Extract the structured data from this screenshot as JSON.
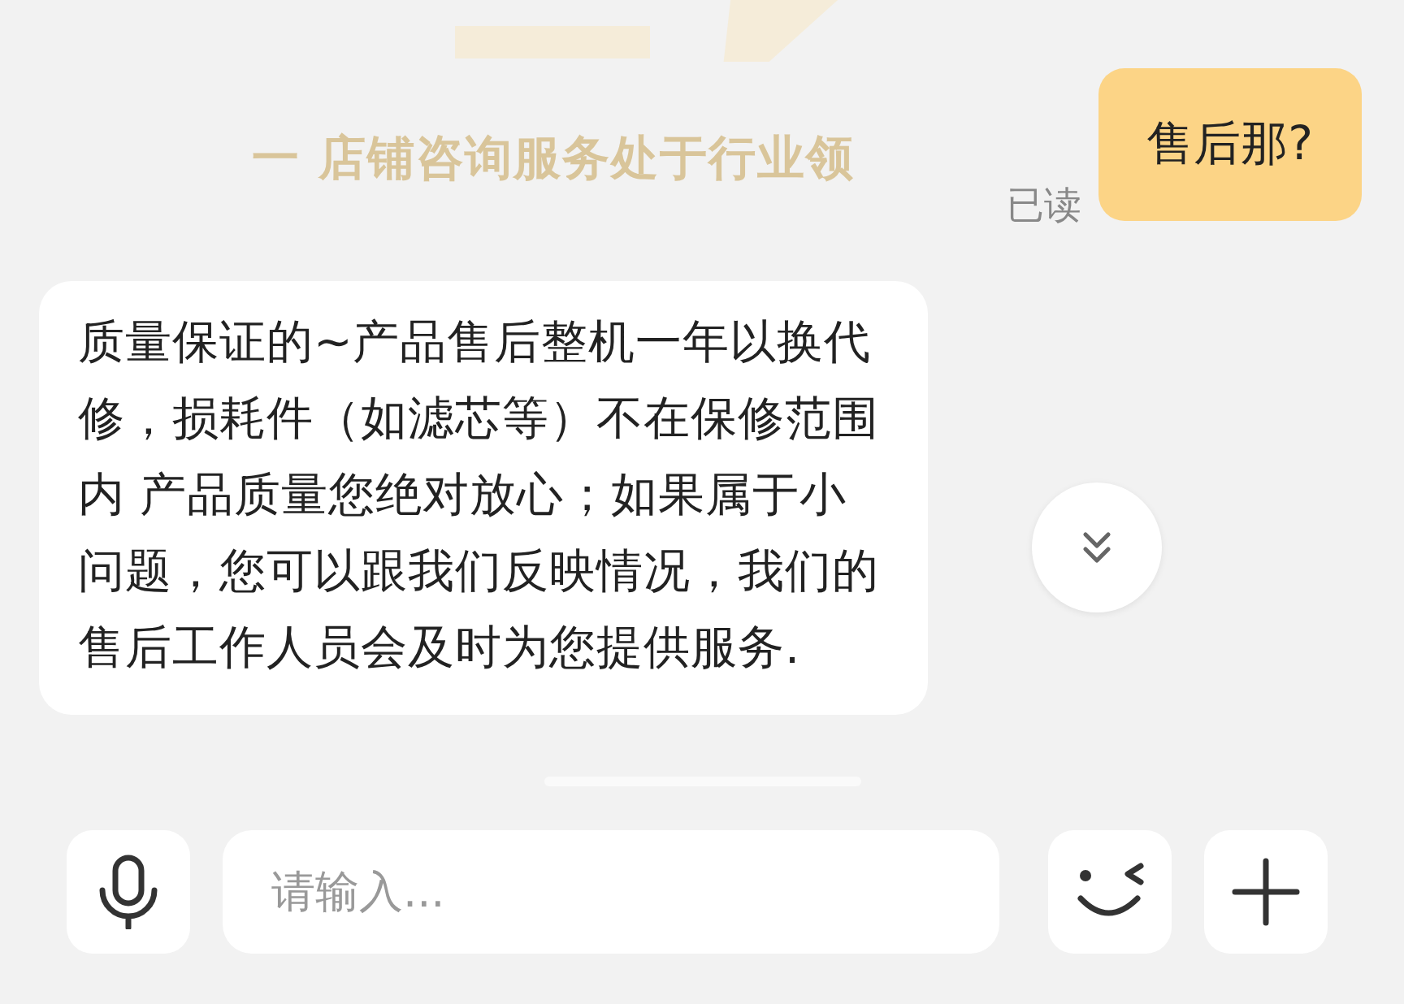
{
  "banner": {
    "text": "一 店铺咨询服务处于行业领"
  },
  "messages": [
    {
      "kind": "outgoing",
      "text": "售后那?",
      "status": "已读"
    },
    {
      "kind": "incoming",
      "lines": [
        "质量保证的~产品售后整机一年以换代",
        "修，损耗件（如滤芯等）不在保修范围",
        "内  产品质量您绝对放心；如果属于小",
        "问题，您可以跟我们反映情况，我们的",
        "售后工作人员会及时为您提供服务."
      ]
    }
  ],
  "input": {
    "placeholder": "请输入..."
  }
}
